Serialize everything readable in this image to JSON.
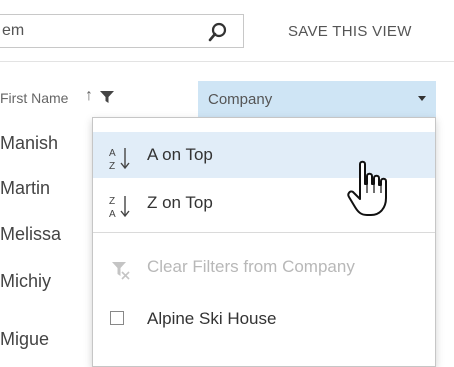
{
  "search": {
    "value": "em"
  },
  "toolbar": {
    "save_view_label": "SAVE THIS VIEW"
  },
  "columns": {
    "first_name": {
      "label": "First Name",
      "sort_indicator": "↑"
    },
    "company": {
      "label": "Company"
    }
  },
  "rows": [
    "Manish",
    "Martin",
    "Melissa",
    "Michiy",
    "Migue"
  ],
  "menu": {
    "a_on_top": "A on Top",
    "z_on_top": "Z on Top",
    "clear_filters": "Clear Filters from Company",
    "options": [
      "Alpine Ski House"
    ]
  },
  "icons": {
    "search": "search-icon",
    "filter": "filter-icon",
    "chevron": "chevron-down-icon",
    "sort_az": "sort-a-z-icon",
    "sort_za": "sort-z-a-icon",
    "clear_filter": "clear-filter-icon",
    "cursor": "hand-pointer-icon"
  },
  "colors": {
    "header_highlight": "#cfe5f5",
    "menu_hover": "#e1edf8"
  }
}
